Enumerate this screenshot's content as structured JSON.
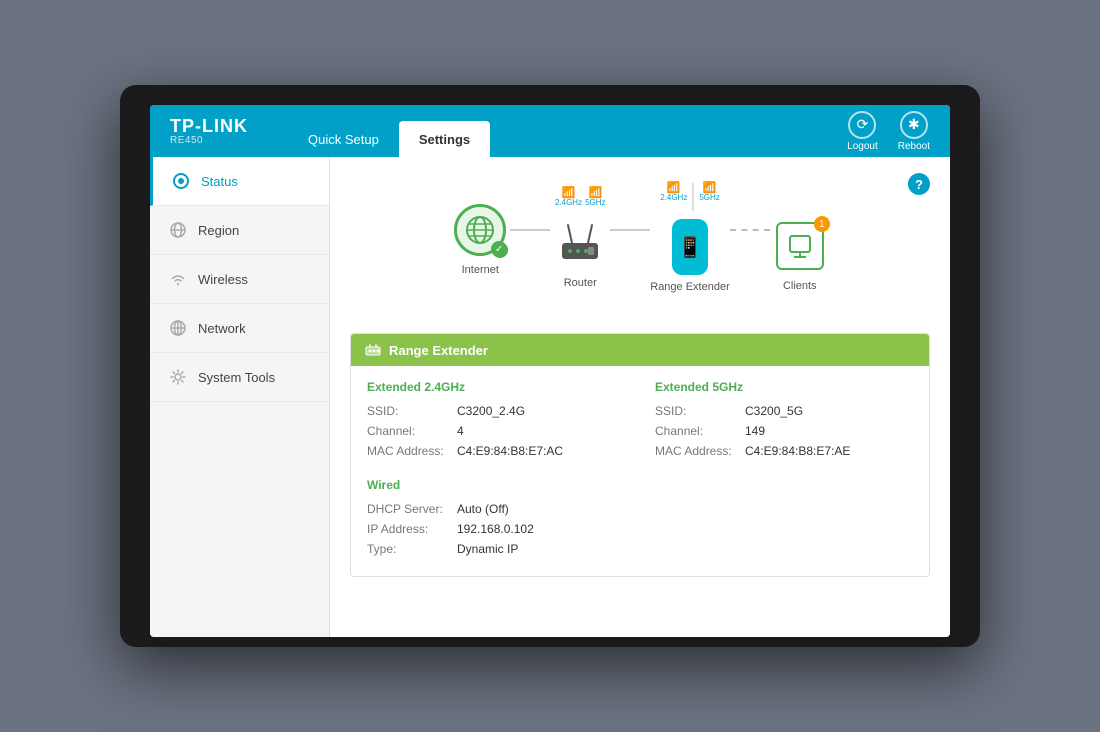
{
  "brand": {
    "name": "TP-LINK",
    "model": "RE450"
  },
  "header": {
    "tabs": [
      {
        "id": "quick-setup",
        "label": "Quick Setup",
        "active": false
      },
      {
        "id": "settings",
        "label": "Settings",
        "active": true
      }
    ],
    "actions": [
      {
        "id": "logout",
        "label": "Logout",
        "icon": "⟳"
      },
      {
        "id": "reboot",
        "label": "Reboot",
        "icon": "✱"
      }
    ]
  },
  "sidebar": {
    "items": [
      {
        "id": "status",
        "label": "Status",
        "icon": "◉",
        "active": true
      },
      {
        "id": "region",
        "label": "Region",
        "icon": "⊕",
        "active": false
      },
      {
        "id": "wireless",
        "label": "Wireless",
        "icon": "▦",
        "active": false
      },
      {
        "id": "network",
        "label": "Network",
        "icon": "⊙",
        "active": false
      },
      {
        "id": "system-tools",
        "label": "System Tools",
        "icon": "⚙",
        "active": false
      }
    ]
  },
  "topology": {
    "help_label": "?",
    "nodes": [
      {
        "id": "internet",
        "label": "Internet"
      },
      {
        "id": "router",
        "label": "Router",
        "bands": [
          "2.4GHz",
          "5GHz"
        ]
      },
      {
        "id": "range-extender",
        "label": "Range Extender",
        "bands": [
          "2.4GHz",
          "5GHz"
        ]
      },
      {
        "id": "clients",
        "label": "Clients",
        "badge": "1"
      }
    ]
  },
  "range_extender": {
    "section_title": "Range Extender",
    "extended_24ghz": {
      "title": "Extended 2.4GHz",
      "fields": [
        {
          "label": "SSID:",
          "value": "C3200_2.4G"
        },
        {
          "label": "Channel:",
          "value": "4"
        },
        {
          "label": "MAC Address:",
          "value": "C4:E9:84:B8:E7:AC"
        }
      ]
    },
    "extended_5ghz": {
      "title": "Extended 5GHz",
      "fields": [
        {
          "label": "SSID:",
          "value": "C3200_5G"
        },
        {
          "label": "Channel:",
          "value": "149"
        },
        {
          "label": "MAC Address:",
          "value": "C4:E9:84:B8:E7:AE"
        }
      ]
    },
    "wired": {
      "title": "Wired",
      "fields": [
        {
          "label": "DHCP Server:",
          "value": "Auto (Off)"
        },
        {
          "label": "IP Address:",
          "value": "192.168.0.102"
        },
        {
          "label": "Type:",
          "value": "Dynamic IP"
        }
      ]
    }
  }
}
